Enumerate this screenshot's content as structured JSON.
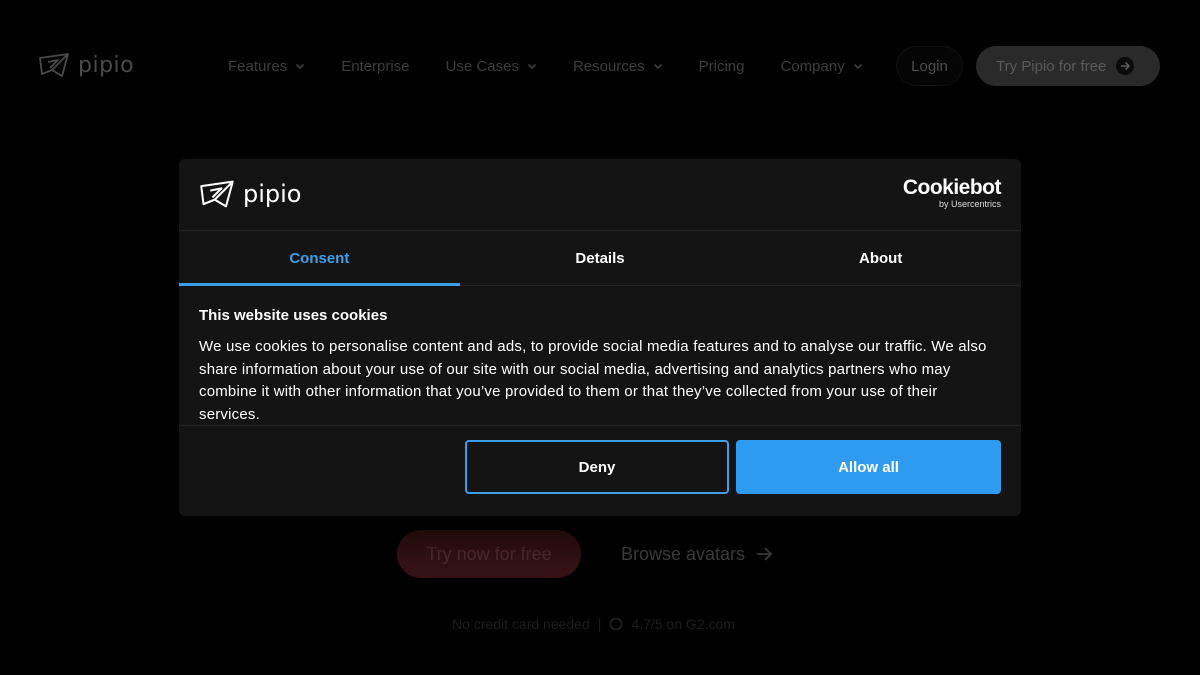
{
  "site": {
    "logo_text": "pipio",
    "nav": [
      {
        "label": "Features",
        "dropdown": true
      },
      {
        "label": "Enterprise",
        "dropdown": false
      },
      {
        "label": "Use Cases",
        "dropdown": true
      },
      {
        "label": "Resources",
        "dropdown": true
      },
      {
        "label": "Pricing",
        "dropdown": false
      },
      {
        "label": "Company",
        "dropdown": true
      }
    ],
    "login_label": "Login",
    "try_label": "Try Pipio for free",
    "hero": {
      "cta_label": "Try now for free",
      "browse_label": "Browse avatars",
      "subline_left": "No credit card needed",
      "subline_sep": "|",
      "rating": "4.7/5 on G2.com"
    }
  },
  "cookie_dialog": {
    "logo_text": "pipio",
    "provider": "Cookiebot",
    "provider_by": "by Usercentrics",
    "tabs": [
      {
        "label": "Consent",
        "active": true
      },
      {
        "label": "Details",
        "active": false
      },
      {
        "label": "About",
        "active": false
      }
    ],
    "title": "This website uses cookies",
    "text": "We use cookies to personalise content and ads, to provide social media features and to analyse our traffic. We also share information about your use of our site with our social media, advertising and analytics partners who may combine it with other information that you’ve provided to them or that they’ve collected from your use of their services.",
    "deny_label": "Deny",
    "allow_label": "Allow all"
  },
  "colors": {
    "accent": "#3d9fe8",
    "allow_bg": "#2f9bf0",
    "dialog_bg": "#141414",
    "page_bg": "#000000"
  },
  "icons": [
    "pipio-logo-icon",
    "chevron-down-icon",
    "arrow-right-icon",
    "g2-icon"
  ]
}
